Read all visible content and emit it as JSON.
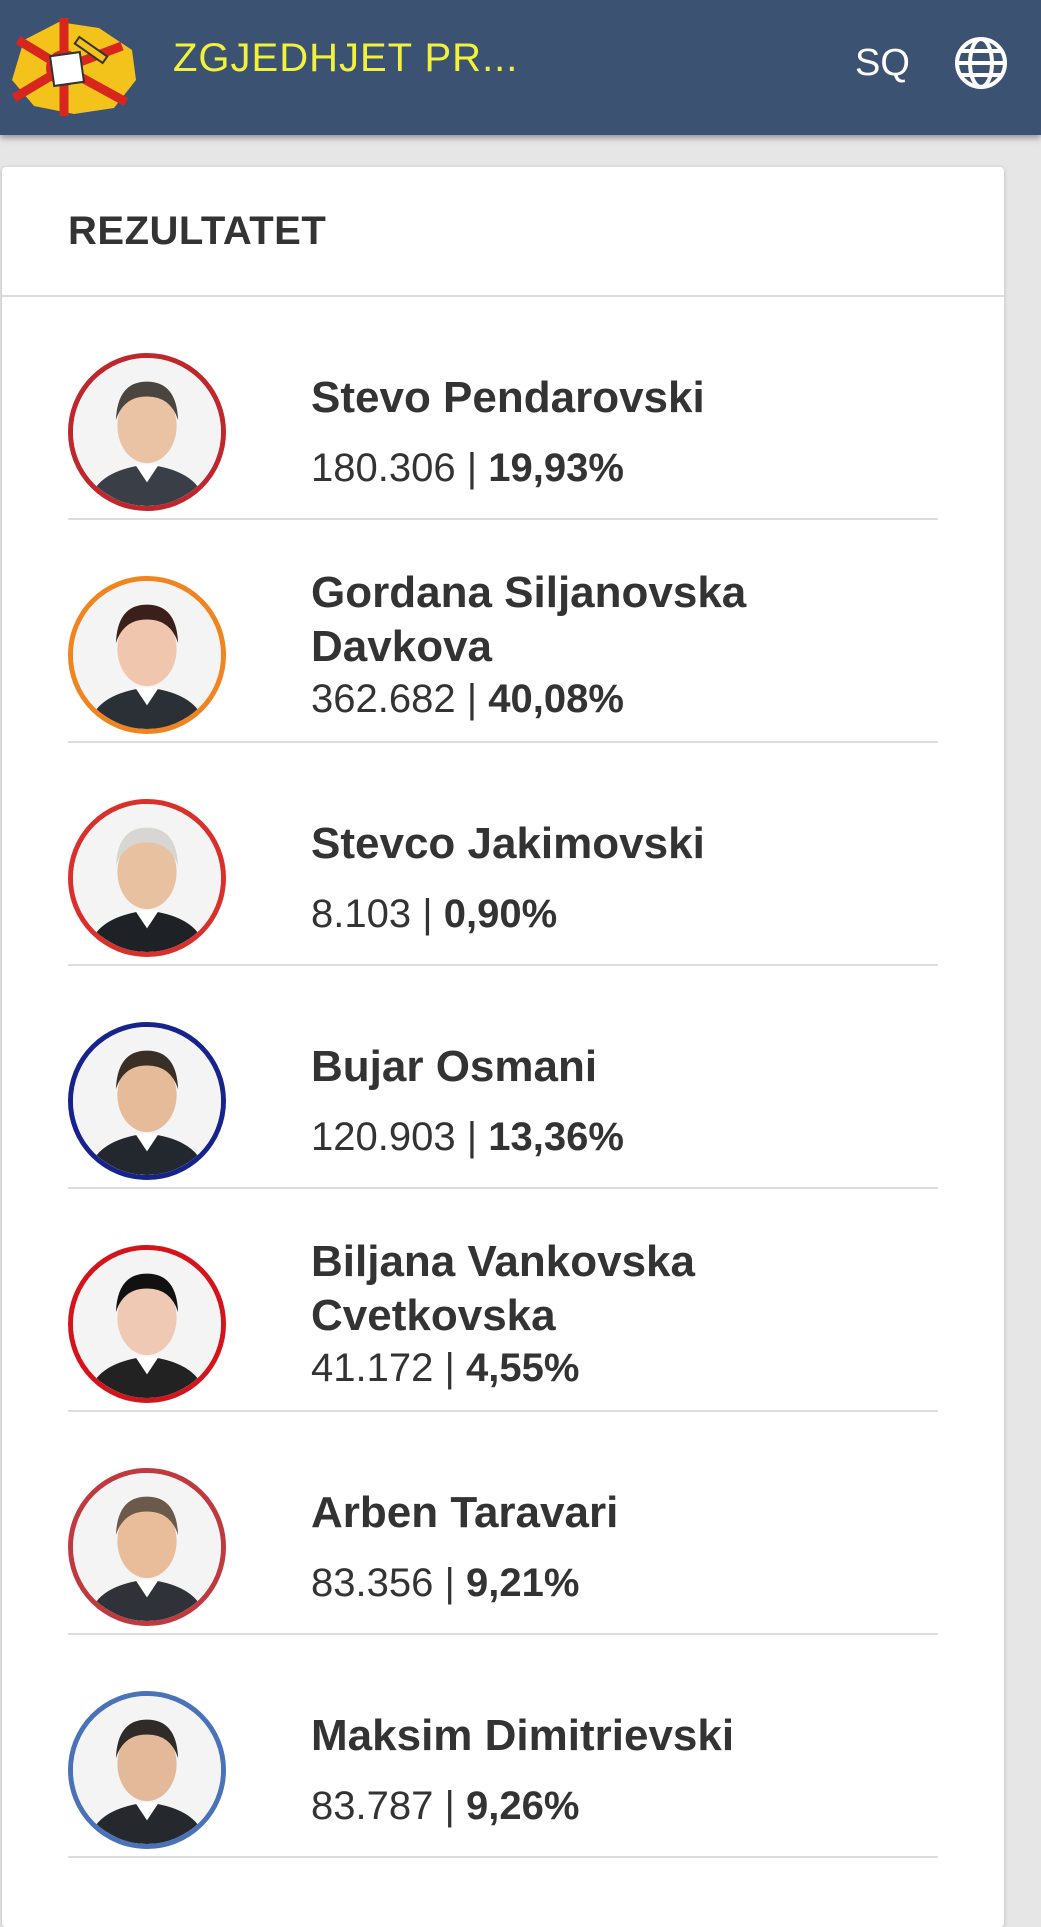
{
  "header": {
    "title": "ZGJEDHJET PR...",
    "language": "SQ",
    "logo_icon": "macedonia-ballot-logo-icon",
    "globe_icon": "globe-icon"
  },
  "results": {
    "title": "REZULTATET",
    "candidates": [
      {
        "name": "Stevo Pendarovski",
        "votes": "180.306",
        "separator": " | ",
        "percent": "19,93%",
        "ring_color": "#c0272d"
      },
      {
        "name": "Gordana Siljanovska Davkova",
        "votes": "362.682",
        "separator": " | ",
        "percent": "40,08%",
        "ring_color": "#f0841e"
      },
      {
        "name": "Stevco Jakimovski",
        "votes": "8.103",
        "separator": " | ",
        "percent": "0,90%",
        "ring_color": "#d9302c"
      },
      {
        "name": "Bujar Osmani",
        "votes": "120.903",
        "separator": " | ",
        "percent": "13,36%",
        "ring_color": "#17238c"
      },
      {
        "name": "Biljana Vankovska Cvetkovska",
        "votes": "41.172",
        "separator": " | ",
        "percent": "4,55%",
        "ring_color": "#d4141a"
      },
      {
        "name": "Arben Taravari",
        "votes": "83.356",
        "separator": " | ",
        "percent": "9,21%",
        "ring_color": "#c0393f"
      },
      {
        "name": "Maksim Dimitrievski",
        "votes": "83.787",
        "separator": " | ",
        "percent": "9,26%",
        "ring_color": "#4a72b8"
      }
    ]
  }
}
